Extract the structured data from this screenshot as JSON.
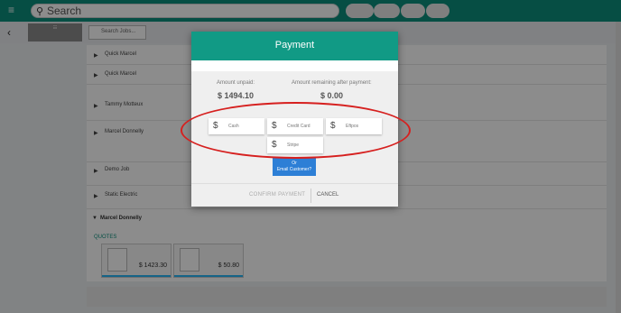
{
  "topbar": {
    "search_placeholder": "Search",
    "buttons": [
      "",
      "",
      "",
      ""
    ]
  },
  "subbar": {
    "tab_label": "",
    "search_jobs_placeholder": "Search Jobs..."
  },
  "jobs": [
    {
      "name": "Quick Marcel"
    },
    {
      "name": "Quick Marcel"
    },
    {
      "name": "Tammy Motteux"
    },
    {
      "name": "Marcel Donnelly"
    },
    {
      "name": "Demo Job"
    },
    {
      "name": "Static Electric"
    }
  ],
  "expanded": {
    "name": "Marcel Donnelly",
    "section_header": "QUOTES",
    "cards": [
      {
        "amount": "$ 1423.30"
      },
      {
        "amount": "$ 50.80"
      }
    ]
  },
  "footer": {
    "text": ""
  },
  "modal": {
    "title": "Payment",
    "amount_unpaid_label": "Amount unpaid:",
    "amount_unpaid_value": "$ 1494.10",
    "amount_remaining_label": "Amount remaining after payment:",
    "amount_remaining_value": "$ 0.00",
    "methods": [
      {
        "icon": "dollar-icon",
        "label": "Cash"
      },
      {
        "icon": "dollar-icon",
        "label": "Credit Card"
      },
      {
        "icon": "dollar-icon",
        "label": "Eftpos"
      },
      {
        "icon": "dollar-icon",
        "label": "Stripe"
      }
    ],
    "email_or": "Or",
    "email_label": "Email Customer?",
    "confirm_label": "CONFIRM PAYMENT",
    "cancel_label": "CANCEL"
  },
  "colors": {
    "brand": "#119a85",
    "email_button": "#2d7fd6",
    "highlight": "#d6201f"
  }
}
